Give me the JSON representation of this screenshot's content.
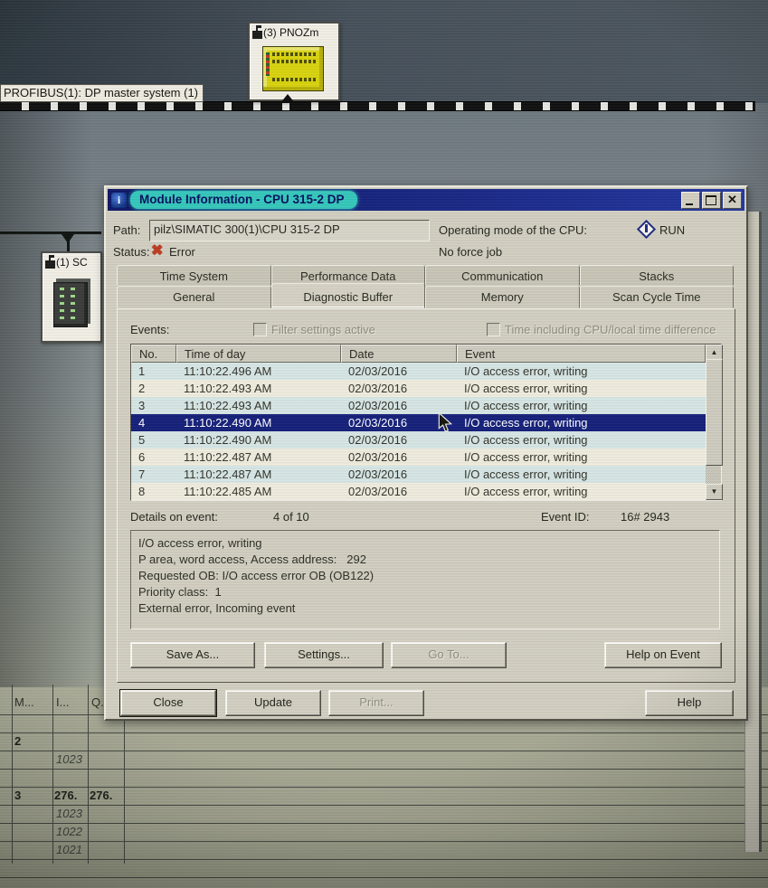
{
  "colors": {
    "title_accent": "#35c8bc",
    "titlebar_blue": "#16216e",
    "selection_navy": "#15207a",
    "error_red": "#c03a20"
  },
  "desktop": {
    "profibus_label": "PROFIBUS(1): DP master system (1)",
    "station_top_label": "(3) PNOZm",
    "station_left_label": "(1) SC"
  },
  "dialog": {
    "title": "Module Information - CPU 315-2 DP",
    "path_label": "Path:",
    "path_value": "pilz\\SIMATIC 300(1)\\CPU 315-2 DP",
    "status_label": "Status:",
    "status_value": "Error",
    "opmode_label": "Operating mode of the CPU:",
    "opmode_value": "RUN",
    "force_job": "No force job",
    "tabs_back": [
      "Time System",
      "Performance Data",
      "Communication",
      "Stacks"
    ],
    "tabs_front": [
      "General",
      "Diagnostic Buffer",
      "Memory",
      "Scan Cycle Time"
    ],
    "active_tab": "Diagnostic Buffer",
    "events_label": "Events:",
    "filter_checkbox_label": "Filter settings active",
    "time_checkbox_label": "Time including CPU/local time difference",
    "table": {
      "headers": [
        "No.",
        "Time of day",
        "Date",
        "Event"
      ],
      "rows": [
        [
          "1",
          "11:10:22.496 AM",
          "02/03/2016",
          "I/O access error, writing"
        ],
        [
          "2",
          "11:10:22.493 AM",
          "02/03/2016",
          "I/O access error, writing"
        ],
        [
          "3",
          "11:10:22.493 AM",
          "02/03/2016",
          "I/O access error, writing"
        ],
        [
          "4",
          "11:10:22.490 AM",
          "02/03/2016",
          "I/O access error, writing"
        ],
        [
          "5",
          "11:10:22.490 AM",
          "02/03/2016",
          "I/O access error, writing"
        ],
        [
          "6",
          "11:10:22.487 AM",
          "02/03/2016",
          "I/O access error, writing"
        ],
        [
          "7",
          "11:10:22.487 AM",
          "02/03/2016",
          "I/O access error, writing"
        ],
        [
          "8",
          "11:10:22.485 AM",
          "02/03/2016",
          "I/O access error, writing"
        ]
      ],
      "selected_row_no": "4"
    },
    "details_label": "Details on event:",
    "details_count": "4 of 10",
    "eventid_label": "Event ID:",
    "eventid_value": "16# 2943",
    "details_lines": [
      "I/O access error, writing",
      "P area, word access, Access address:   292",
      "Requested OB: I/O access error OB (OB122)",
      "Priority class:  1",
      "External error, Incoming event"
    ],
    "buttons": {
      "save_as": "Save As...",
      "settings": "Settings...",
      "go_to": "Go To...",
      "help_on_event": "Help on Event",
      "close": "Close",
      "update": "Update",
      "print": "Print...",
      "help": "Help"
    }
  },
  "bottom_table": {
    "headers": [
      "M...",
      "I...",
      "Q.."
    ],
    "rows": [
      [
        "",
        "",
        ""
      ],
      [
        "2",
        "",
        ""
      ],
      [
        "",
        "1023",
        ""
      ],
      [
        "",
        "",
        ""
      ],
      [
        "3",
        "276.",
        "276."
      ],
      [
        "",
        "1023",
        ""
      ],
      [
        "",
        "1022",
        ""
      ],
      [
        "",
        "1021",
        ""
      ],
      [
        "",
        "",
        ""
      ]
    ]
  }
}
